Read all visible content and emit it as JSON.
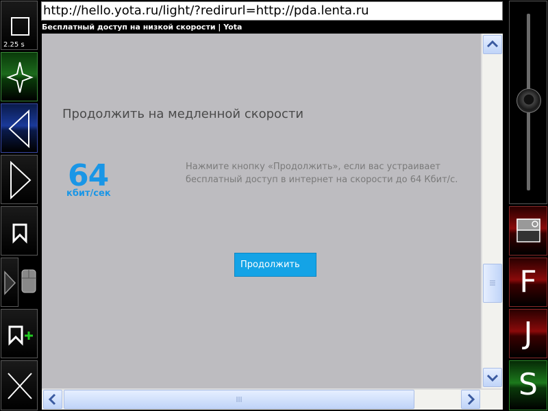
{
  "browser": {
    "url": "http://hello.yota.ru/light/?redirurl=http://pda.lenta.ru",
    "page_title": "Бесплатный доступ на низкой скорости | Yota",
    "timer": "2.25 s"
  },
  "page": {
    "heading": "Продолжить на медленной скорости",
    "speed_value": "64",
    "speed_unit": "кбит/сек",
    "description": "Нажмите кнопку «Продолжить», если вас устраивает бесплатный доступ в интернет на скорости до 64 Кбит/с.",
    "continue_label": "Продолжить"
  },
  "right_toolbar": {
    "f_label": "F",
    "j_label": "J",
    "s_label": "S"
  },
  "icons": {
    "left": [
      "stop-icon",
      "home-icon",
      "back-arrow-icon",
      "forward-arrow-icon",
      "bookmark-icon",
      "mode-toggle-icon",
      "mouse-icon",
      "add-bookmark-icon",
      "close-icon"
    ],
    "right": [
      "zoom-slider",
      "screen-toggle-icon"
    ]
  },
  "colors": {
    "accent_blue": "#1a96e6",
    "button_blue": "#14a3e6",
    "page_bg": "#bdbcc0",
    "red_button": "#8a0a0a",
    "green_button": "#1c7a1c"
  }
}
